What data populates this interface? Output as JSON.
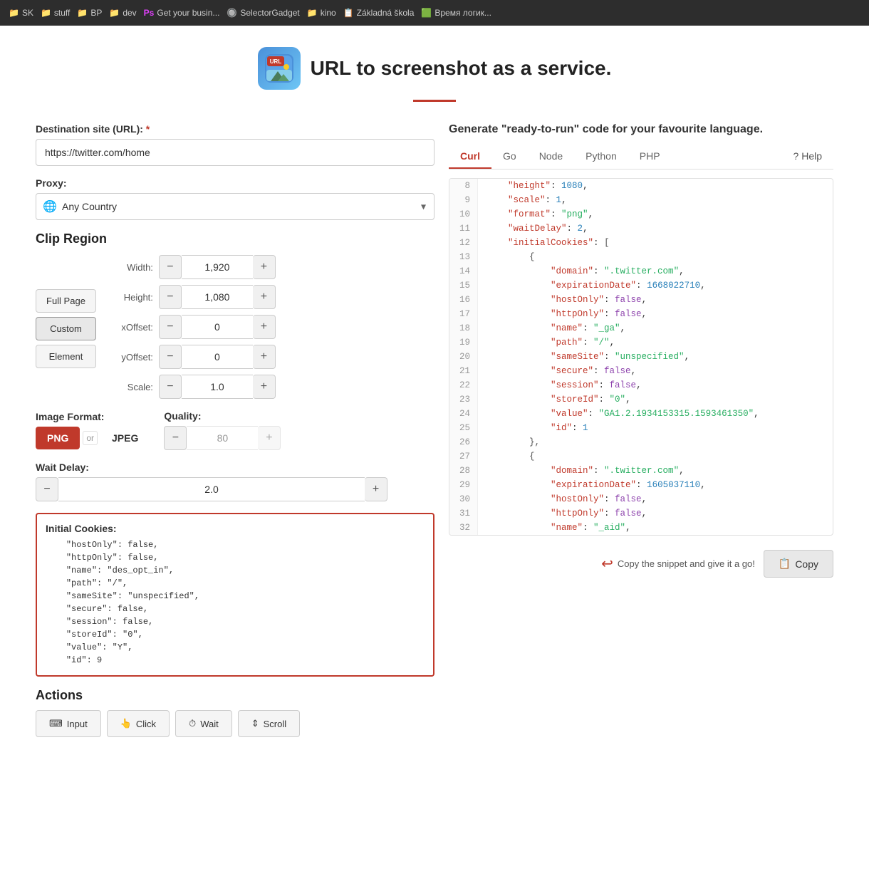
{
  "browser": {
    "tabs": [
      {
        "icon": "📁",
        "label": "SK"
      },
      {
        "icon": "📁",
        "label": "stuff"
      },
      {
        "icon": "📁",
        "label": "BP"
      },
      {
        "icon": "📁",
        "label": "dev"
      },
      {
        "icon": "🅿",
        "label": "Get your busin..."
      },
      {
        "icon": "🔘",
        "label": "SelectorGadget"
      },
      {
        "icon": "📁",
        "label": "kino"
      },
      {
        "icon": "📋",
        "label": "Základná škola"
      },
      {
        "icon": "🟩",
        "label": "Время логик..."
      }
    ]
  },
  "header": {
    "title": "URL to screenshot as a service.",
    "logo_emoji": "🏔"
  },
  "form": {
    "url_label": "Destination site (URL):",
    "url_required": "*",
    "url_value": "https://twitter.com/home",
    "proxy_label": "Proxy:",
    "proxy_placeholder": "Any Country",
    "clip_region_title": "Clip Region",
    "clip_buttons": [
      "Full Page",
      "Custom",
      "Element"
    ],
    "clip_active": "Custom",
    "fields": [
      {
        "label": "Width:",
        "value": "1,920"
      },
      {
        "label": "Height:",
        "value": "1,080"
      },
      {
        "label": "xOffset:",
        "value": "0"
      },
      {
        "label": "yOffset:",
        "value": "0"
      },
      {
        "label": "Scale:",
        "value": "1.0"
      }
    ],
    "image_format_label": "Image Format:",
    "formats": [
      "PNG",
      "JPEG"
    ],
    "active_format": "PNG",
    "quality_label": "Quality:",
    "quality_value": "80",
    "wait_delay_label": "Wait Delay:",
    "wait_delay_value": "2.0",
    "cookies_label": "Initial Cookies:",
    "cookies_content": "    \"hostOnly\": false,\n    \"httpOnly\": false,\n    \"name\": \"des_opt_in\",\n    \"path\": \"/\",\n    \"sameSite\": \"unspecified\",\n    \"secure\": false,\n    \"session\": false,\n    \"storeId\": \"0\",\n    \"value\": \"Y\",\n    \"id\": 9",
    "actions_title": "Actions",
    "action_buttons": [
      {
        "icon": "⌨",
        "label": "Input"
      },
      {
        "icon": "👆",
        "label": "Click"
      },
      {
        "icon": "⏱",
        "label": "Wait"
      },
      {
        "icon": "⇕",
        "label": "Scroll"
      }
    ]
  },
  "code_panel": {
    "title": "Generate \"ready-to-run\" code for your favourite language.",
    "tabs": [
      "Curl",
      "Go",
      "Node",
      "Python",
      "PHP",
      "? Help"
    ],
    "active_tab": "Curl",
    "lines": [
      {
        "num": 8,
        "content": "    \"height\": 1080,"
      },
      {
        "num": 9,
        "content": "    \"scale\": 1,"
      },
      {
        "num": 10,
        "content": "    \"format\": \"png\","
      },
      {
        "num": 11,
        "content": "    \"waitDelay\": 2,"
      },
      {
        "num": 12,
        "content": "    \"initialCookies\": ["
      },
      {
        "num": 13,
        "content": "        {"
      },
      {
        "num": 14,
        "content": "            \"domain\": \".twitter.com\","
      },
      {
        "num": 15,
        "content": "            \"expirationDate\": 1668022710,"
      },
      {
        "num": 16,
        "content": "            \"hostOnly\": false,"
      },
      {
        "num": 17,
        "content": "            \"httpOnly\": false,"
      },
      {
        "num": 18,
        "content": "            \"name\": \"_ga\","
      },
      {
        "num": 19,
        "content": "            \"path\": \"/\","
      },
      {
        "num": 20,
        "content": "            \"sameSite\": \"unspecified\","
      },
      {
        "num": 21,
        "content": "            \"secure\": false,"
      },
      {
        "num": 22,
        "content": "            \"session\": false,"
      },
      {
        "num": 23,
        "content": "            \"storeId\": \"0\","
      },
      {
        "num": 24,
        "content": "            \"value\": \"GA1.2.1934153315.1593461350\","
      },
      {
        "num": 25,
        "content": "            \"id\": 1"
      },
      {
        "num": 26,
        "content": "        },"
      },
      {
        "num": 27,
        "content": "        {"
      },
      {
        "num": 28,
        "content": "            \"domain\": \".twitter.com\","
      },
      {
        "num": 29,
        "content": "            \"expirationDate\": 1605037110,"
      },
      {
        "num": 30,
        "content": "            \"hostOnly\": false,"
      },
      {
        "num": 31,
        "content": "            \"httpOnly\": false,"
      },
      {
        "num": 32,
        "content": "            \"name\": \"_aid\","
      }
    ],
    "copy_hint": "Copy the snippet and give it a go!",
    "copy_label": "Copy"
  }
}
